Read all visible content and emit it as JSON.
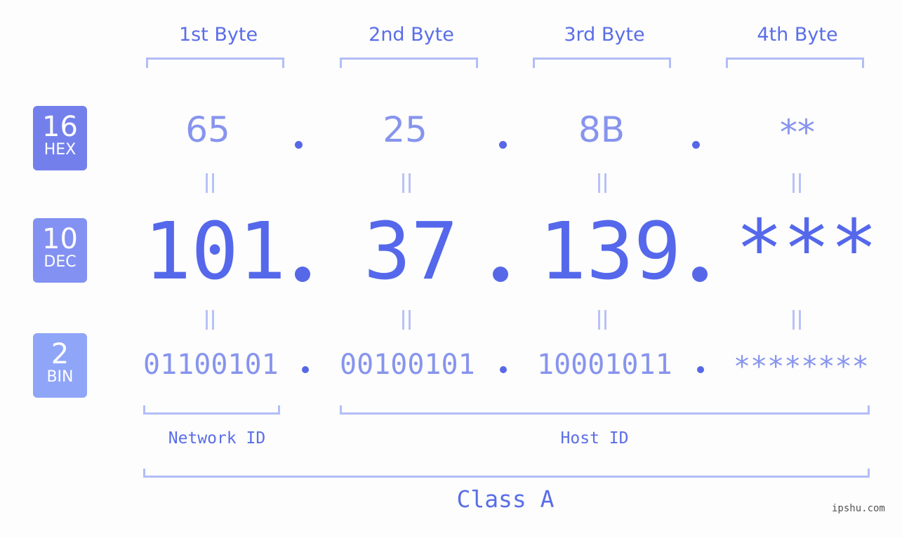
{
  "bytes_header": [
    "1st Byte",
    "2nd Byte",
    "3rd Byte",
    "4th Byte"
  ],
  "badges": [
    {
      "base": "16",
      "label": "HEX",
      "color": "#7380ec"
    },
    {
      "base": "10",
      "label": "DEC",
      "color": "#8291f2"
    },
    {
      "base": "2",
      "label": "BIN",
      "color": "#8fa5f7"
    }
  ],
  "hex": [
    "65",
    "25",
    "8B",
    "**"
  ],
  "dec": [
    "101",
    "37",
    "139",
    "***"
  ],
  "bin": [
    "01100101",
    "00100101",
    "10001011",
    "********"
  ],
  "separator": ".",
  "equals_symbol": "||",
  "network_id_label": "Network ID",
  "host_id_label": "Host ID",
  "class_label": "Class A",
  "watermark": "ipshu.com",
  "colors": {
    "primary": "#5568eb",
    "light": "#8794ee",
    "bracket": "#b3bdf8"
  }
}
